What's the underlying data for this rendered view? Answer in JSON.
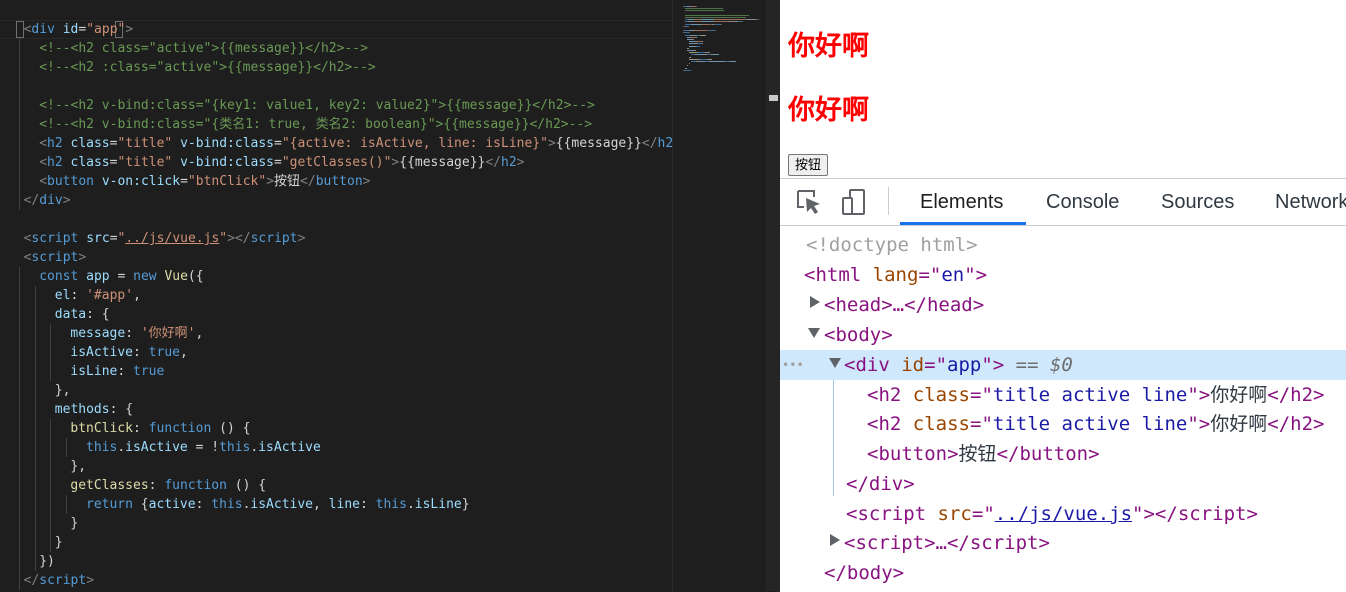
{
  "editor": {
    "lines": [
      {
        "indent": 1,
        "tokens": [
          [
            "punc",
            "<"
          ],
          [
            "tag",
            "div"
          ],
          [
            "text",
            " "
          ],
          [
            "attr",
            "id"
          ],
          [
            "text",
            "="
          ],
          [
            "str",
            "\"app\""
          ],
          [
            "punc",
            ">"
          ]
        ]
      },
      {
        "indent": 2,
        "tokens": [
          [
            "comment",
            "<!--<h2 class=\"active\">{{message}}</h2>-->"
          ]
        ]
      },
      {
        "indent": 2,
        "tokens": [
          [
            "comment",
            "<!--<h2 :class=\"active\">{{message}}</h2>-->"
          ]
        ]
      },
      {
        "indent": 0,
        "tokens": []
      },
      {
        "indent": 2,
        "tokens": [
          [
            "comment",
            "<!--<h2 v-bind:class=\"{key1: value1, key2: value2}\">{{message}}</h2>-->"
          ]
        ]
      },
      {
        "indent": 2,
        "tokens": [
          [
            "comment",
            "<!--<h2 v-bind:class=\"{类名1: true, 类名2: boolean}\">{{message}}</h2>-->"
          ]
        ]
      },
      {
        "indent": 2,
        "tokens": [
          [
            "punc",
            "<"
          ],
          [
            "tag",
            "h2"
          ],
          [
            "text",
            " "
          ],
          [
            "attr",
            "class"
          ],
          [
            "text",
            "="
          ],
          [
            "str",
            "\"title\""
          ],
          [
            "text",
            " "
          ],
          [
            "attr",
            "v-bind:class"
          ],
          [
            "text",
            "="
          ],
          [
            "str",
            "\"{active: isActive, line: isLine}\""
          ],
          [
            "punc",
            ">"
          ],
          [
            "text",
            "{{message}}"
          ],
          [
            "punc",
            "</"
          ],
          [
            "tag",
            "h2"
          ],
          [
            "punc",
            ">"
          ]
        ]
      },
      {
        "indent": 2,
        "tokens": [
          [
            "punc",
            "<"
          ],
          [
            "tag",
            "h2"
          ],
          [
            "text",
            " "
          ],
          [
            "attr",
            "class"
          ],
          [
            "text",
            "="
          ],
          [
            "str",
            "\"title\""
          ],
          [
            "text",
            " "
          ],
          [
            "attr",
            "v-bind:class"
          ],
          [
            "text",
            "="
          ],
          [
            "str",
            "\"getClasses()\""
          ],
          [
            "punc",
            ">"
          ],
          [
            "text",
            "{{message}}"
          ],
          [
            "punc",
            "</"
          ],
          [
            "tag",
            "h2"
          ],
          [
            "punc",
            ">"
          ]
        ]
      },
      {
        "indent": 2,
        "tokens": [
          [
            "punc",
            "<"
          ],
          [
            "tag",
            "button"
          ],
          [
            "text",
            " "
          ],
          [
            "attr",
            "v-on:click"
          ],
          [
            "text",
            "="
          ],
          [
            "str",
            "\"btnClick\""
          ],
          [
            "punc",
            ">"
          ],
          [
            "text",
            "按钮"
          ],
          [
            "punc",
            "</"
          ],
          [
            "tag",
            "button"
          ],
          [
            "punc",
            ">"
          ]
        ]
      },
      {
        "indent": 1,
        "tokens": [
          [
            "punc",
            "</"
          ],
          [
            "tag",
            "div"
          ],
          [
            "punc",
            ">"
          ]
        ]
      },
      {
        "indent": 0,
        "tokens": []
      },
      {
        "indent": 1,
        "tokens": [
          [
            "punc",
            "<"
          ],
          [
            "tag",
            "script"
          ],
          [
            "text",
            " "
          ],
          [
            "attr",
            "src"
          ],
          [
            "text",
            "="
          ],
          [
            "str",
            "\""
          ],
          [
            "strul",
            "../js/vue.js"
          ],
          [
            "str",
            "\""
          ],
          [
            "punc",
            "></"
          ],
          [
            "tag",
            "script"
          ],
          [
            "punc",
            ">"
          ]
        ]
      },
      {
        "indent": 1,
        "tokens": [
          [
            "punc",
            "<"
          ],
          [
            "tag",
            "script"
          ],
          [
            "punc",
            ">"
          ]
        ]
      },
      {
        "indent": 2,
        "tokens": [
          [
            "kw",
            "const"
          ],
          [
            "text",
            " "
          ],
          [
            "prop",
            "app"
          ],
          [
            "text",
            " = "
          ],
          [
            "kw",
            "new"
          ],
          [
            "text",
            " "
          ],
          [
            "fn",
            "Vue"
          ],
          [
            "text",
            "({"
          ]
        ]
      },
      {
        "indent": 3,
        "tokens": [
          [
            "prop",
            "el"
          ],
          [
            "text",
            ": "
          ],
          [
            "str",
            "'#app'"
          ],
          [
            "text",
            ","
          ]
        ]
      },
      {
        "indent": 3,
        "tokens": [
          [
            "prop",
            "data"
          ],
          [
            "text",
            ": {"
          ]
        ]
      },
      {
        "indent": 4,
        "tokens": [
          [
            "prop",
            "message"
          ],
          [
            "text",
            ": "
          ],
          [
            "str",
            "'你好啊'"
          ],
          [
            "text",
            ","
          ]
        ]
      },
      {
        "indent": 4,
        "tokens": [
          [
            "prop",
            "isActive"
          ],
          [
            "text",
            ": "
          ],
          [
            "kw",
            "true"
          ],
          [
            "text",
            ","
          ]
        ]
      },
      {
        "indent": 4,
        "tokens": [
          [
            "prop",
            "isLine"
          ],
          [
            "text",
            ": "
          ],
          [
            "kw",
            "true"
          ]
        ]
      },
      {
        "indent": 3,
        "tokens": [
          [
            "text",
            "},"
          ]
        ]
      },
      {
        "indent": 3,
        "tokens": [
          [
            "prop",
            "methods"
          ],
          [
            "text",
            ": {"
          ]
        ]
      },
      {
        "indent": 4,
        "tokens": [
          [
            "fn",
            "btnClick"
          ],
          [
            "text",
            ": "
          ],
          [
            "kw",
            "function"
          ],
          [
            "text",
            " () {"
          ]
        ]
      },
      {
        "indent": 5,
        "tokens": [
          [
            "kw",
            "this"
          ],
          [
            "text",
            "."
          ],
          [
            "prop",
            "isActive"
          ],
          [
            "text",
            " = !"
          ],
          [
            "kw",
            "this"
          ],
          [
            "text",
            "."
          ],
          [
            "prop",
            "isActive"
          ]
        ]
      },
      {
        "indent": 4,
        "tokens": [
          [
            "text",
            "},"
          ]
        ]
      },
      {
        "indent": 4,
        "tokens": [
          [
            "fn",
            "getClasses"
          ],
          [
            "text",
            ": "
          ],
          [
            "kw",
            "function"
          ],
          [
            "text",
            " () {"
          ]
        ]
      },
      {
        "indent": 5,
        "tokens": [
          [
            "kw",
            "return"
          ],
          [
            "text",
            " {"
          ],
          [
            "prop",
            "active"
          ],
          [
            "text",
            ": "
          ],
          [
            "kw",
            "this"
          ],
          [
            "text",
            "."
          ],
          [
            "prop",
            "isActive"
          ],
          [
            "text",
            ", "
          ],
          [
            "prop",
            "line"
          ],
          [
            "text",
            ": "
          ],
          [
            "kw",
            "this"
          ],
          [
            "text",
            "."
          ],
          [
            "prop",
            "isLine"
          ],
          [
            "text",
            "}"
          ]
        ]
      },
      {
        "indent": 4,
        "tokens": [
          [
            "text",
            "}"
          ]
        ]
      },
      {
        "indent": 3,
        "tokens": [
          [
            "text",
            "}"
          ]
        ]
      },
      {
        "indent": 2,
        "tokens": [
          [
            "text",
            "})"
          ]
        ]
      },
      {
        "indent": 1,
        "tokens": [
          [
            "punc",
            "</"
          ],
          [
            "tag",
            "script"
          ],
          [
            "punc",
            ">"
          ]
        ]
      }
    ]
  },
  "page": {
    "heading_1": "你好啊",
    "heading_2": "你好啊",
    "button_label": "按钮"
  },
  "devtools": {
    "tabs": [
      "Elements",
      "Console",
      "Sources",
      "Network"
    ],
    "active_tab": "Elements",
    "tree": {
      "doctype": "<!doctype html>",
      "html_open": [
        "<",
        "html",
        " ",
        "lang",
        "=\"",
        "en",
        "\">"
      ],
      "head": [
        "<",
        "head",
        ">…</",
        "head",
        ">"
      ],
      "body_open": [
        "<",
        "body",
        ">"
      ],
      "div_open": [
        "<",
        "div",
        " ",
        "id",
        "=\"",
        "app",
        "\">"
      ],
      "selected_marker": "== $0",
      "h2_1": [
        "<",
        "h2",
        " ",
        "class",
        "=\"",
        "title active line",
        "\">",
        "你好啊",
        "</",
        "h2",
        ">"
      ],
      "h2_2": [
        "<",
        "h2",
        " ",
        "class",
        "=\"",
        "title active line",
        "\">",
        "你好啊",
        "</",
        "h2",
        ">"
      ],
      "button": [
        "<",
        "button",
        ">",
        "按钮",
        "</",
        "button",
        ">"
      ],
      "div_close": [
        "</",
        "div",
        ">"
      ],
      "script_src": [
        "<",
        "script",
        " ",
        "src",
        "=\"",
        "../js/vue.js",
        "\"></",
        "script",
        ">"
      ],
      "script_inline": [
        "<",
        "script",
        ">…</",
        "script",
        ">"
      ],
      "body_close": [
        "</",
        "body",
        ">"
      ],
      "ellipsis": "•••"
    }
  },
  "colors": {
    "heading_red": "#ff0000",
    "active_tab_underline": "#1a73e8",
    "selected_row": "#cfe8fc"
  }
}
